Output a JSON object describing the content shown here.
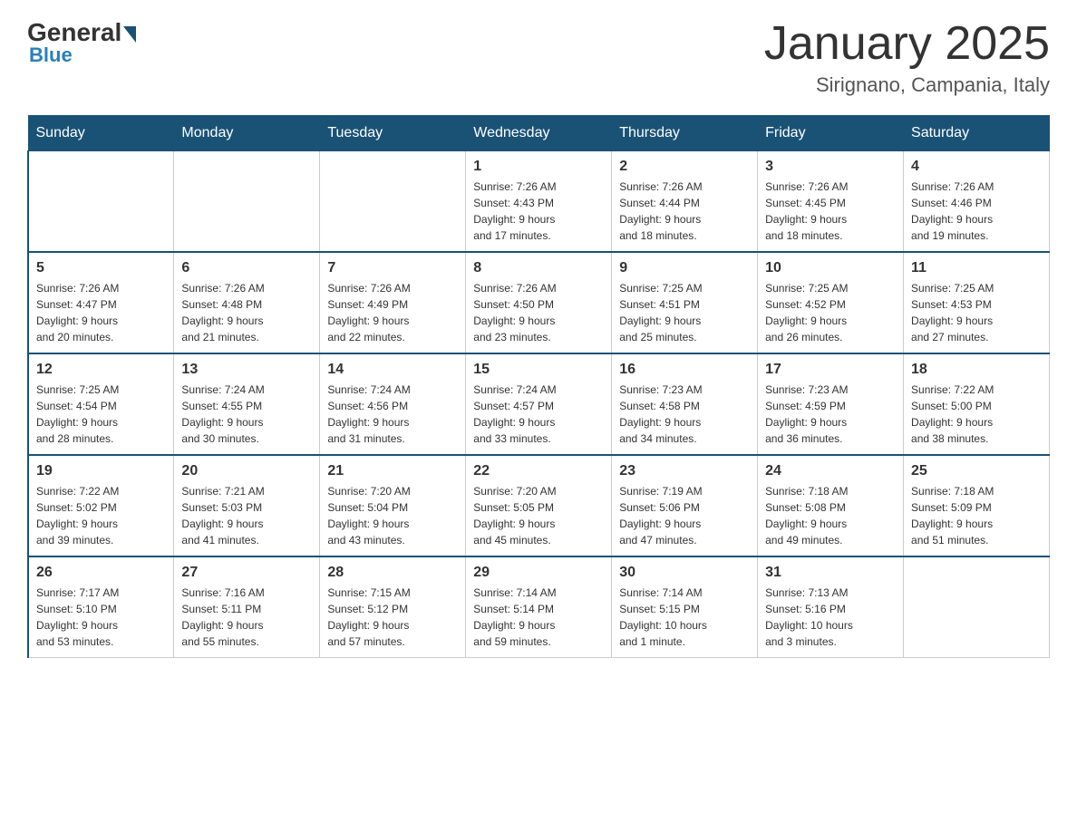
{
  "header": {
    "logo_general": "General",
    "logo_blue": "Blue",
    "month_title": "January 2025",
    "location": "Sirignano, Campania, Italy"
  },
  "days_of_week": [
    "Sunday",
    "Monday",
    "Tuesday",
    "Wednesday",
    "Thursday",
    "Friday",
    "Saturday"
  ],
  "weeks": [
    [
      {
        "day": "",
        "info": ""
      },
      {
        "day": "",
        "info": ""
      },
      {
        "day": "",
        "info": ""
      },
      {
        "day": "1",
        "info": "Sunrise: 7:26 AM\nSunset: 4:43 PM\nDaylight: 9 hours\nand 17 minutes."
      },
      {
        "day": "2",
        "info": "Sunrise: 7:26 AM\nSunset: 4:44 PM\nDaylight: 9 hours\nand 18 minutes."
      },
      {
        "day": "3",
        "info": "Sunrise: 7:26 AM\nSunset: 4:45 PM\nDaylight: 9 hours\nand 18 minutes."
      },
      {
        "day": "4",
        "info": "Sunrise: 7:26 AM\nSunset: 4:46 PM\nDaylight: 9 hours\nand 19 minutes."
      }
    ],
    [
      {
        "day": "5",
        "info": "Sunrise: 7:26 AM\nSunset: 4:47 PM\nDaylight: 9 hours\nand 20 minutes."
      },
      {
        "day": "6",
        "info": "Sunrise: 7:26 AM\nSunset: 4:48 PM\nDaylight: 9 hours\nand 21 minutes."
      },
      {
        "day": "7",
        "info": "Sunrise: 7:26 AM\nSunset: 4:49 PM\nDaylight: 9 hours\nand 22 minutes."
      },
      {
        "day": "8",
        "info": "Sunrise: 7:26 AM\nSunset: 4:50 PM\nDaylight: 9 hours\nand 23 minutes."
      },
      {
        "day": "9",
        "info": "Sunrise: 7:25 AM\nSunset: 4:51 PM\nDaylight: 9 hours\nand 25 minutes."
      },
      {
        "day": "10",
        "info": "Sunrise: 7:25 AM\nSunset: 4:52 PM\nDaylight: 9 hours\nand 26 minutes."
      },
      {
        "day": "11",
        "info": "Sunrise: 7:25 AM\nSunset: 4:53 PM\nDaylight: 9 hours\nand 27 minutes."
      }
    ],
    [
      {
        "day": "12",
        "info": "Sunrise: 7:25 AM\nSunset: 4:54 PM\nDaylight: 9 hours\nand 28 minutes."
      },
      {
        "day": "13",
        "info": "Sunrise: 7:24 AM\nSunset: 4:55 PM\nDaylight: 9 hours\nand 30 minutes."
      },
      {
        "day": "14",
        "info": "Sunrise: 7:24 AM\nSunset: 4:56 PM\nDaylight: 9 hours\nand 31 minutes."
      },
      {
        "day": "15",
        "info": "Sunrise: 7:24 AM\nSunset: 4:57 PM\nDaylight: 9 hours\nand 33 minutes."
      },
      {
        "day": "16",
        "info": "Sunrise: 7:23 AM\nSunset: 4:58 PM\nDaylight: 9 hours\nand 34 minutes."
      },
      {
        "day": "17",
        "info": "Sunrise: 7:23 AM\nSunset: 4:59 PM\nDaylight: 9 hours\nand 36 minutes."
      },
      {
        "day": "18",
        "info": "Sunrise: 7:22 AM\nSunset: 5:00 PM\nDaylight: 9 hours\nand 38 minutes."
      }
    ],
    [
      {
        "day": "19",
        "info": "Sunrise: 7:22 AM\nSunset: 5:02 PM\nDaylight: 9 hours\nand 39 minutes."
      },
      {
        "day": "20",
        "info": "Sunrise: 7:21 AM\nSunset: 5:03 PM\nDaylight: 9 hours\nand 41 minutes."
      },
      {
        "day": "21",
        "info": "Sunrise: 7:20 AM\nSunset: 5:04 PM\nDaylight: 9 hours\nand 43 minutes."
      },
      {
        "day": "22",
        "info": "Sunrise: 7:20 AM\nSunset: 5:05 PM\nDaylight: 9 hours\nand 45 minutes."
      },
      {
        "day": "23",
        "info": "Sunrise: 7:19 AM\nSunset: 5:06 PM\nDaylight: 9 hours\nand 47 minutes."
      },
      {
        "day": "24",
        "info": "Sunrise: 7:18 AM\nSunset: 5:08 PM\nDaylight: 9 hours\nand 49 minutes."
      },
      {
        "day": "25",
        "info": "Sunrise: 7:18 AM\nSunset: 5:09 PM\nDaylight: 9 hours\nand 51 minutes."
      }
    ],
    [
      {
        "day": "26",
        "info": "Sunrise: 7:17 AM\nSunset: 5:10 PM\nDaylight: 9 hours\nand 53 minutes."
      },
      {
        "day": "27",
        "info": "Sunrise: 7:16 AM\nSunset: 5:11 PM\nDaylight: 9 hours\nand 55 minutes."
      },
      {
        "day": "28",
        "info": "Sunrise: 7:15 AM\nSunset: 5:12 PM\nDaylight: 9 hours\nand 57 minutes."
      },
      {
        "day": "29",
        "info": "Sunrise: 7:14 AM\nSunset: 5:14 PM\nDaylight: 9 hours\nand 59 minutes."
      },
      {
        "day": "30",
        "info": "Sunrise: 7:14 AM\nSunset: 5:15 PM\nDaylight: 10 hours\nand 1 minute."
      },
      {
        "day": "31",
        "info": "Sunrise: 7:13 AM\nSunset: 5:16 PM\nDaylight: 10 hours\nand 3 minutes."
      },
      {
        "day": "",
        "info": ""
      }
    ]
  ]
}
